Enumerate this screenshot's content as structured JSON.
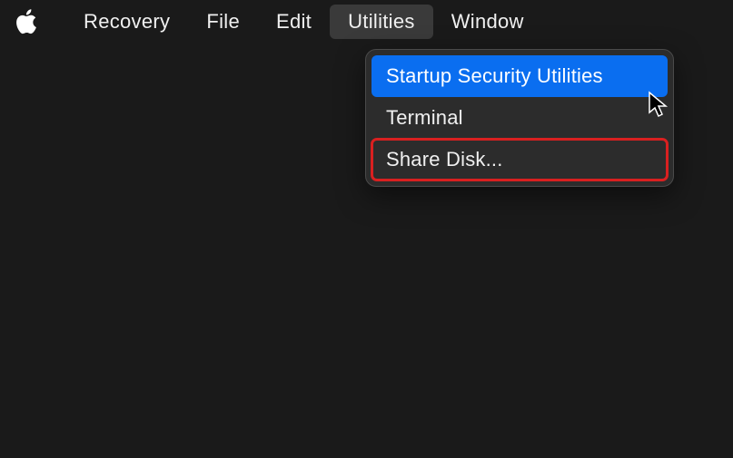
{
  "menubar": {
    "items": [
      {
        "label": "Recovery"
      },
      {
        "label": "File"
      },
      {
        "label": "Edit"
      },
      {
        "label": "Utilities"
      },
      {
        "label": "Window"
      }
    ],
    "active_index": 3
  },
  "dropdown": {
    "items": [
      {
        "label": "Startup Security Utilities",
        "highlighted": true
      },
      {
        "label": "Terminal",
        "highlighted": false
      },
      {
        "label": "Share Disk...",
        "highlighted": false,
        "boxed": true
      }
    ]
  }
}
